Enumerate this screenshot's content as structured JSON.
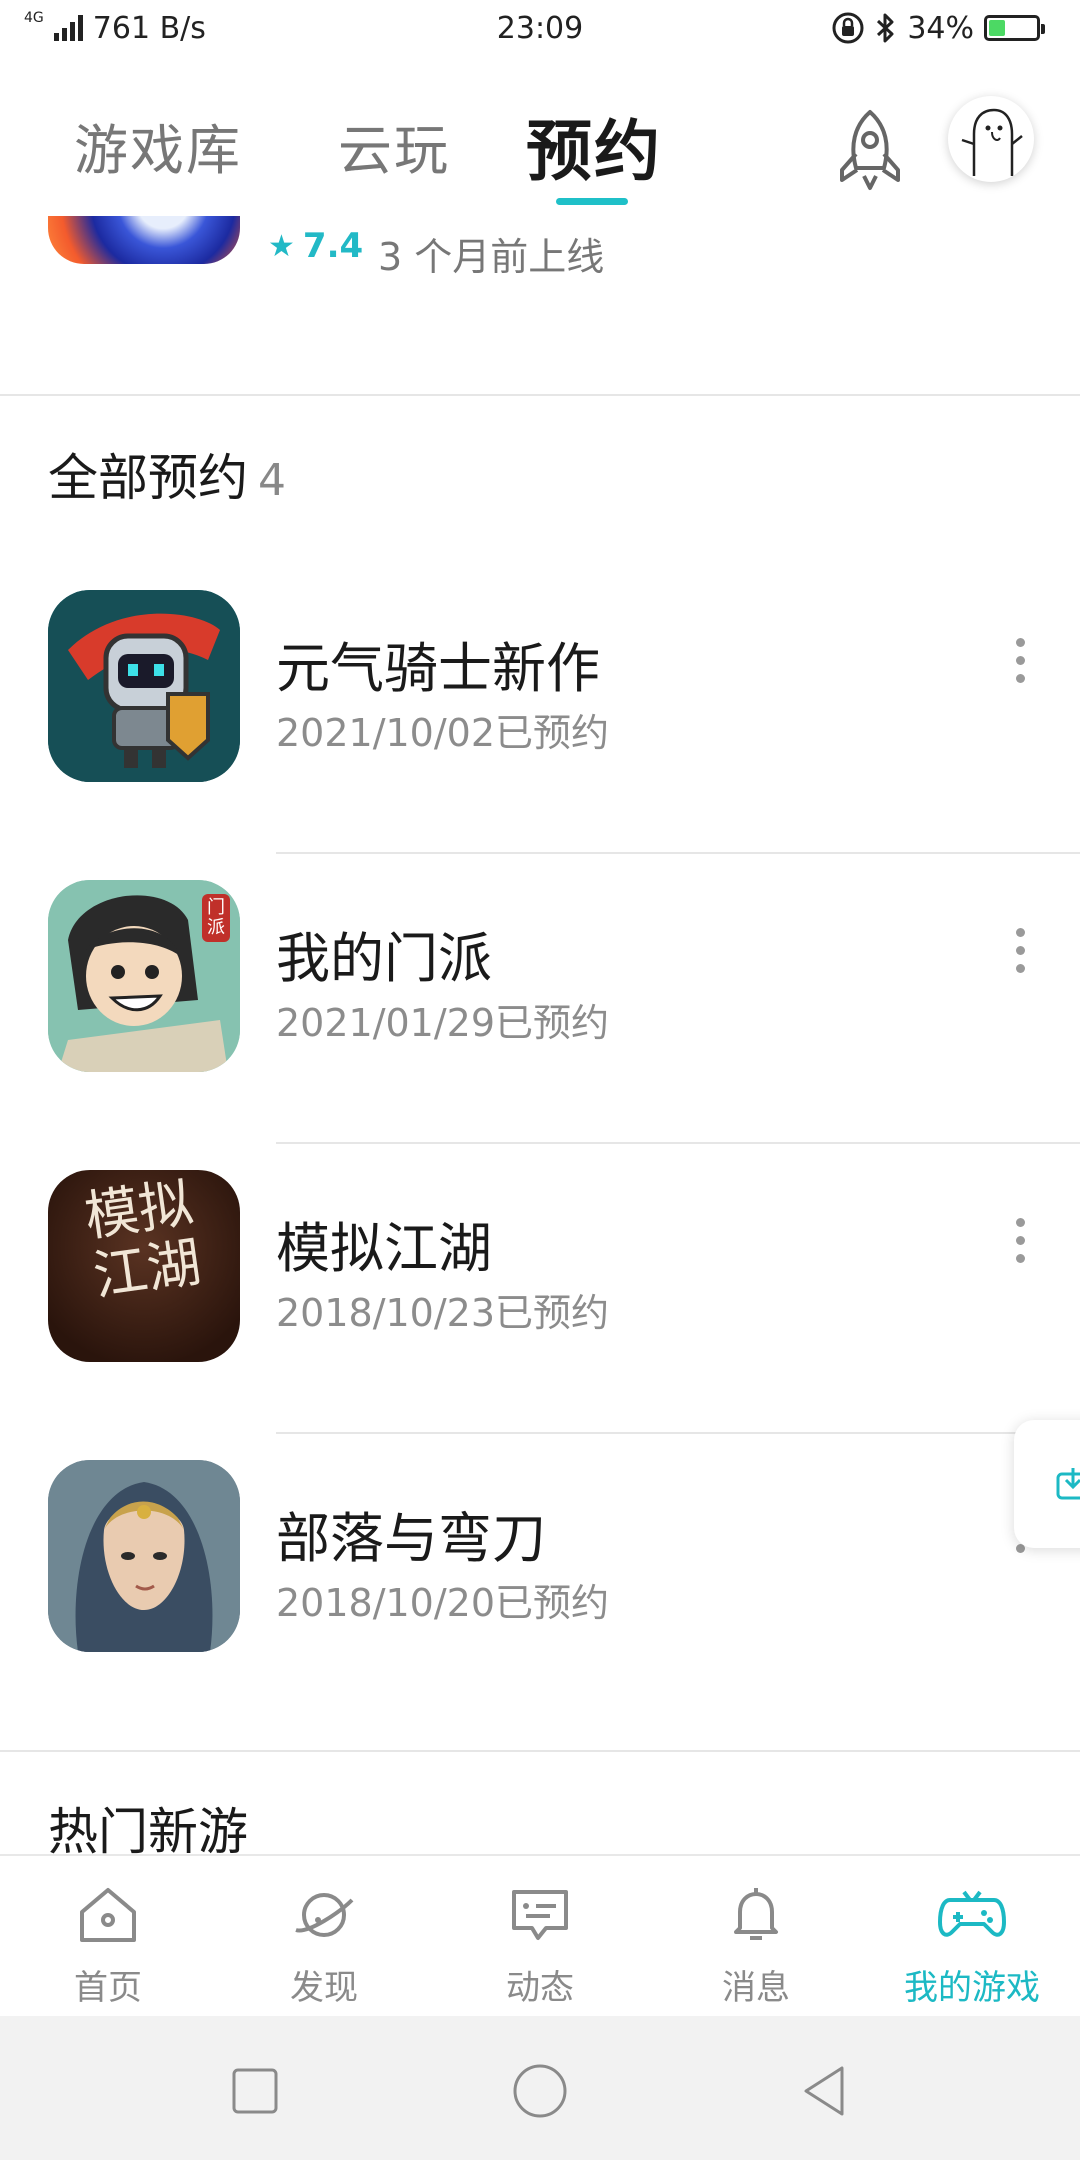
{
  "status_bar": {
    "network": "4G",
    "speed": "761 B/s",
    "time": "23:09",
    "battery": "34%",
    "battery_level": 0.34,
    "battery_color": "#4cd964"
  },
  "header": {
    "tabs": [
      {
        "label": "游戏库"
      },
      {
        "label": "云玩"
      },
      {
        "label": "预约"
      }
    ],
    "active_tab": "预约",
    "accent_color": "#1fc0c8",
    "icons": [
      "rocket-icon",
      "avatar"
    ]
  },
  "previous_item": {
    "rating": "7.4",
    "time_text": "3 个月前上线"
  },
  "reservations": {
    "title": "全部预约",
    "count": "4",
    "items": [
      {
        "name": "元气骑士新作",
        "date": "2021/10/02已预约"
      },
      {
        "name": "我的门派",
        "date": "2021/01/29已预约",
        "badge": "门派"
      },
      {
        "name": "模拟江湖",
        "date": "2018/10/23已预约",
        "art_text": "模拟江湖"
      },
      {
        "name": "部落与弯刀",
        "date": "2018/10/20已预约"
      }
    ]
  },
  "hot_new": {
    "title": "热门新游"
  },
  "bottom_nav": {
    "items": [
      {
        "label": "首页",
        "icon": "home-icon"
      },
      {
        "label": "发现",
        "icon": "planet-icon"
      },
      {
        "label": "动态",
        "icon": "message-icon"
      },
      {
        "label": "消息",
        "icon": "bell-icon"
      },
      {
        "label": "我的游戏",
        "icon": "gamepad-icon"
      }
    ],
    "active": "我的游戏",
    "active_color": "#1cb9c4"
  },
  "system_nav": [
    "square-icon",
    "circle-icon",
    "back-triangle-icon"
  ]
}
